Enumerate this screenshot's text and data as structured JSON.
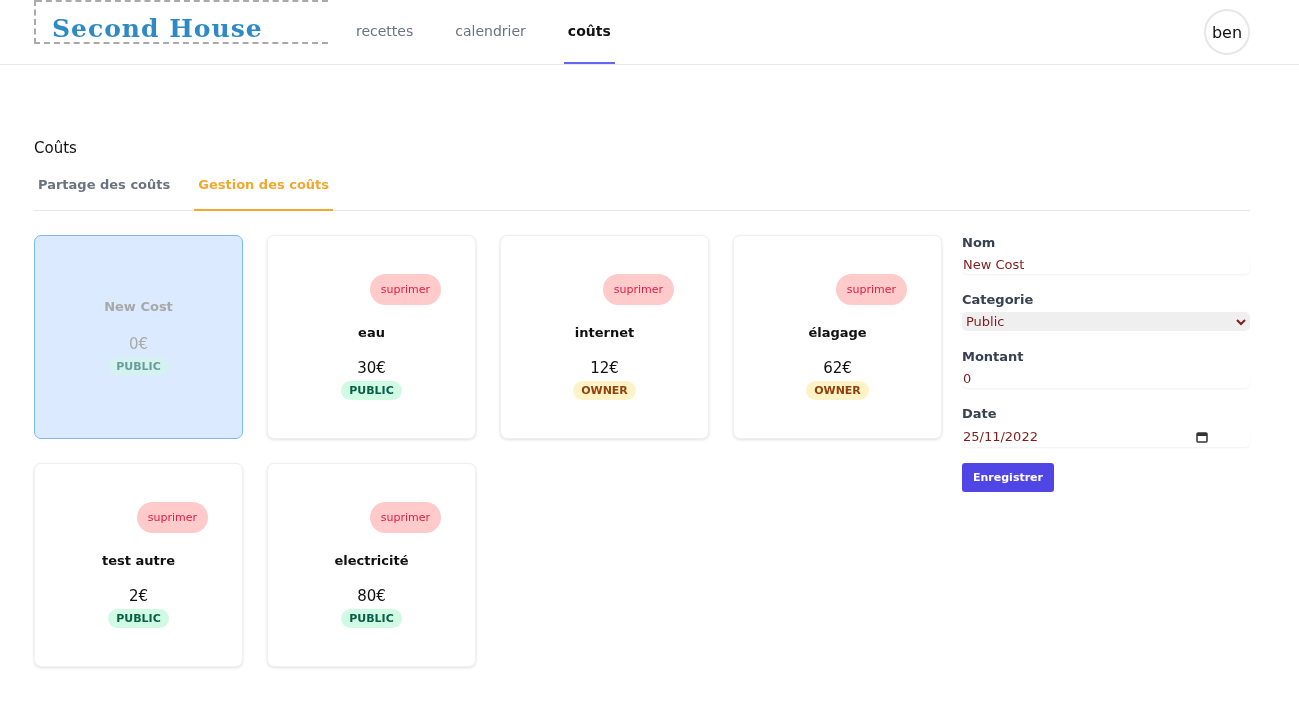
{
  "header": {
    "logo": "Second House",
    "nav": [
      {
        "label": "recettes",
        "selected": false
      },
      {
        "label": "calendrier",
        "selected": false
      },
      {
        "label": "coûts",
        "selected": true
      }
    ],
    "user": "ben"
  },
  "page": {
    "title": "Coûts",
    "tabs": [
      {
        "label": "Partage des coûts",
        "selected": false
      },
      {
        "label": "Gestion des coûts",
        "selected": true
      }
    ]
  },
  "costs": [
    {
      "kind": "draft",
      "selected": true,
      "name": "New Cost",
      "amount": "0€",
      "category": {
        "kind": "public",
        "label": "PUBLIC"
      }
    },
    {
      "kind": "saved",
      "selected": false,
      "delete": "suprimer",
      "name": "eau",
      "amount": "30€",
      "category": {
        "kind": "public",
        "label": "PUBLIC"
      }
    },
    {
      "kind": "saved",
      "selected": false,
      "delete": "suprimer",
      "name": "internet",
      "amount": "12€",
      "category": {
        "kind": "owner",
        "label": "OWNER"
      }
    },
    {
      "kind": "saved",
      "selected": false,
      "delete": "suprimer",
      "name": "élagage",
      "amount": "62€",
      "category": {
        "kind": "owner",
        "label": "OWNER"
      }
    },
    {
      "kind": "saved",
      "selected": false,
      "delete": "suprimer",
      "name": "test autre",
      "amount": "2€",
      "category": {
        "kind": "public",
        "label": "PUBLIC"
      }
    },
    {
      "kind": "saved",
      "selected": false,
      "delete": "suprimer",
      "name": "electricité",
      "amount": "80€",
      "category": {
        "kind": "public",
        "label": "PUBLIC"
      }
    }
  ],
  "form": {
    "fields": [
      {
        "kind": "text",
        "label": "Nom",
        "value": "New Cost"
      },
      {
        "kind": "select",
        "label": "Categorie",
        "value": "Public"
      },
      {
        "kind": "text",
        "label": "Montant",
        "value": "0"
      },
      {
        "kind": "date",
        "label": "Date",
        "value": "25/11/2022"
      }
    ],
    "submit": "Enregistrer"
  }
}
